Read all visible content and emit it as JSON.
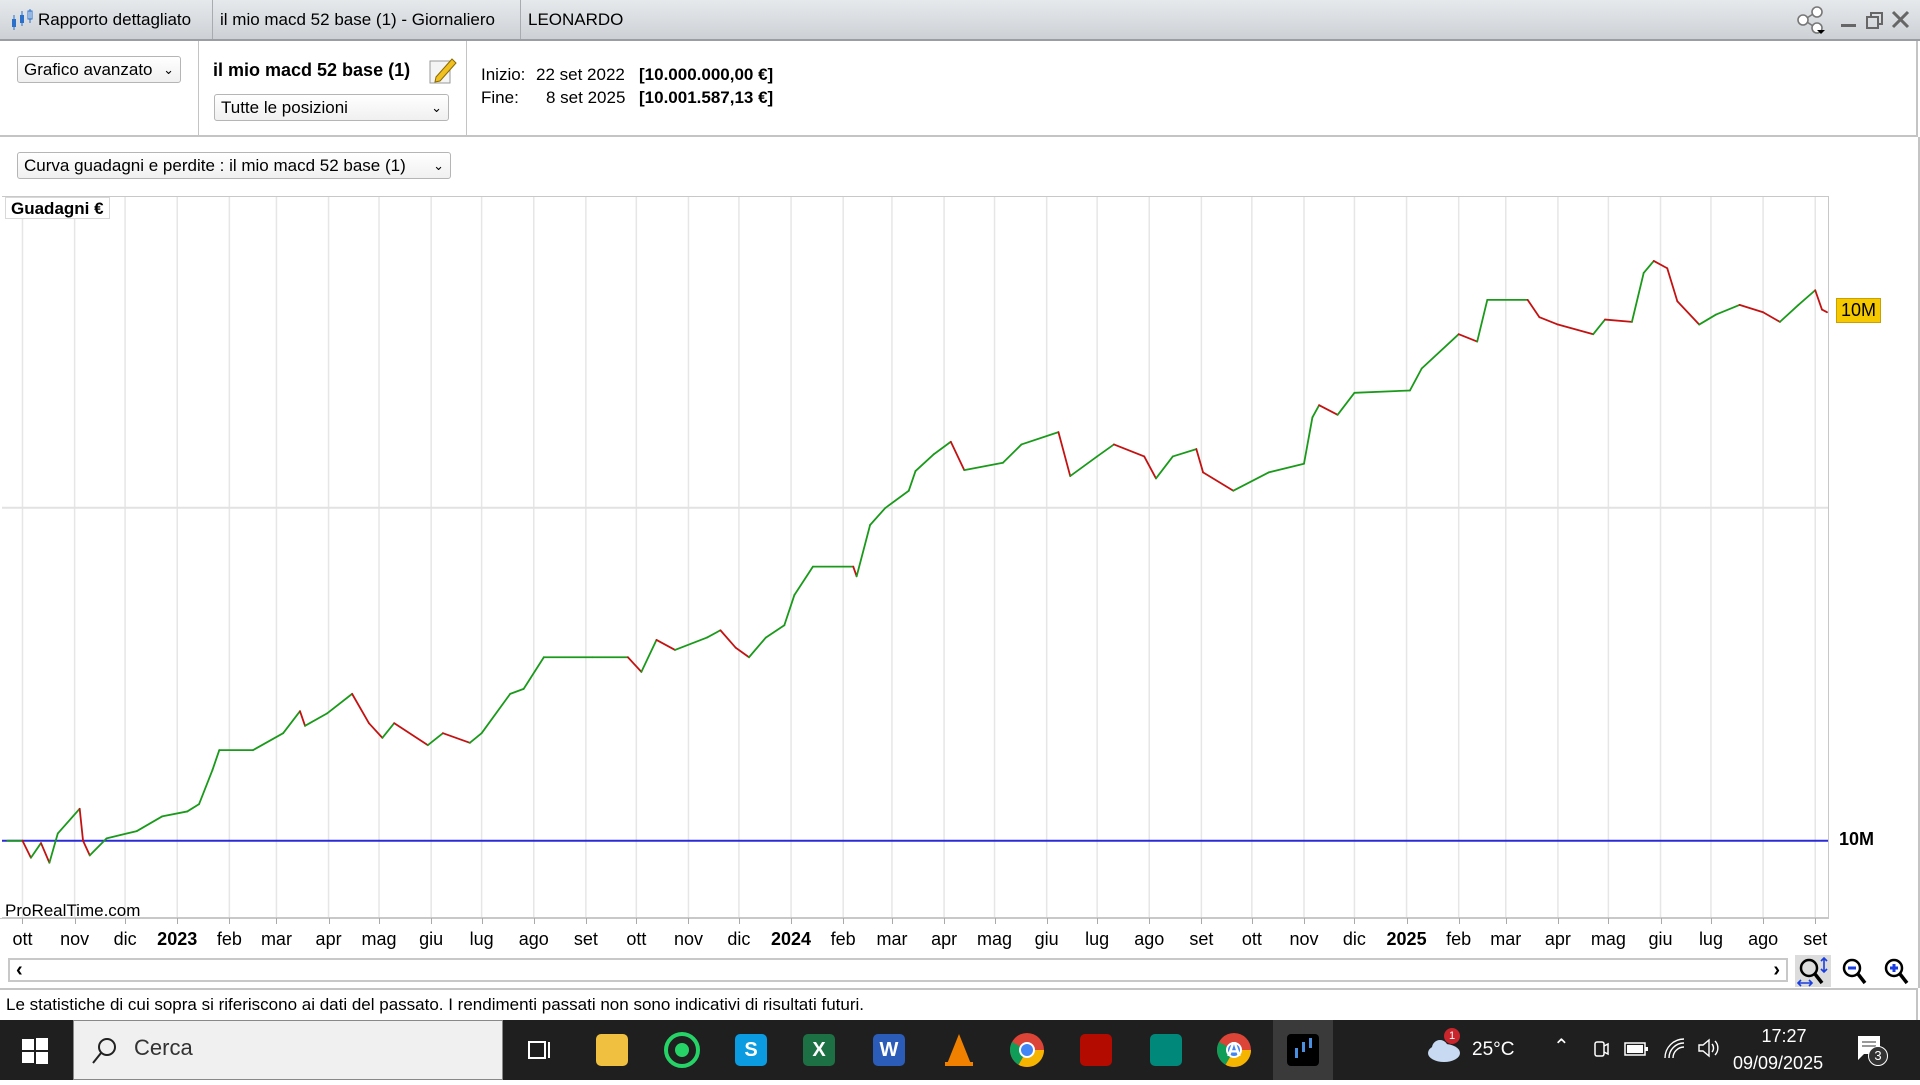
{
  "window": {
    "tabs": [
      {
        "label": "Rapporto dettagliato",
        "icon": "candlestick-icon"
      },
      {
        "label": "il mio macd 52 base (1) - Giornaliero"
      },
      {
        "label": "LEONARDO"
      }
    ],
    "controls": [
      "share-icon",
      "minimize-icon",
      "restore-icon",
      "close-icon"
    ]
  },
  "header": {
    "view_select": "Grafico avanzato",
    "system_name": "il mio macd 52 base (1)",
    "positions_select": "Tutte le posizioni",
    "start_label": "Inizio:",
    "start_date": "22 set 2022",
    "start_value": "[10.000.000,00 €]",
    "end_label": "Fine:",
    "end_date": "8 set 2025",
    "end_value": "[10.001.587,13 €]"
  },
  "curve_select": "Curva guadagni e perdite : il mio macd 52 base (1)",
  "chart_data": {
    "type": "line",
    "ylabel": "Guadagni €",
    "watermark": "ProRealTime.com",
    "xlim": [
      "2022-09-20",
      "2025-09-08"
    ],
    "ylim": [
      9999765,
      10001933
    ],
    "baseline": {
      "value": 10000000,
      "label": "10M",
      "color": "#2b2bd6"
    },
    "last_value_label": "10M",
    "last_value_color": "#f5c800",
    "up_color": "#1a9a1a",
    "down_color": "#c41212",
    "grid": true,
    "x_ticks": [
      {
        "date": "2022-10-01",
        "label": "ott"
      },
      {
        "date": "2022-11-01",
        "label": "nov"
      },
      {
        "date": "2022-12-01",
        "label": "dic"
      },
      {
        "date": "2023-01-01",
        "label": "2023",
        "year": true
      },
      {
        "date": "2023-02-01",
        "label": "feb"
      },
      {
        "date": "2023-03-01",
        "label": "mar"
      },
      {
        "date": "2023-04-01",
        "label": "apr"
      },
      {
        "date": "2023-05-01",
        "label": "mag"
      },
      {
        "date": "2023-06-01",
        "label": "giu"
      },
      {
        "date": "2023-07-01",
        "label": "lug"
      },
      {
        "date": "2023-08-01",
        "label": "ago"
      },
      {
        "date": "2023-09-01",
        "label": "set"
      },
      {
        "date": "2023-10-01",
        "label": "ott"
      },
      {
        "date": "2023-11-01",
        "label": "nov"
      },
      {
        "date": "2023-12-01",
        "label": "dic"
      },
      {
        "date": "2024-01-01",
        "label": "2024",
        "year": true
      },
      {
        "date": "2024-02-01",
        "label": "feb"
      },
      {
        "date": "2024-03-01",
        "label": "mar"
      },
      {
        "date": "2024-04-01",
        "label": "apr"
      },
      {
        "date": "2024-05-01",
        "label": "mag"
      },
      {
        "date": "2024-06-01",
        "label": "giu"
      },
      {
        "date": "2024-07-01",
        "label": "lug"
      },
      {
        "date": "2024-08-01",
        "label": "ago"
      },
      {
        "date": "2024-09-01",
        "label": "set"
      },
      {
        "date": "2024-10-01",
        "label": "ott"
      },
      {
        "date": "2024-11-01",
        "label": "nov"
      },
      {
        "date": "2024-12-01",
        "label": "dic"
      },
      {
        "date": "2025-01-01",
        "label": "2025",
        "year": true
      },
      {
        "date": "2025-02-01",
        "label": "feb"
      },
      {
        "date": "2025-03-01",
        "label": "mar"
      },
      {
        "date": "2025-04-01",
        "label": "apr"
      },
      {
        "date": "2025-05-01",
        "label": "mag"
      },
      {
        "date": "2025-06-01",
        "label": "giu"
      },
      {
        "date": "2025-07-01",
        "label": "lug"
      },
      {
        "date": "2025-08-01",
        "label": "ago"
      },
      {
        "date": "2025-09-01",
        "label": "set"
      }
    ],
    "y_gridlines": [
      10001000
    ],
    "points": [
      [
        "2022-09-22",
        10000000
      ],
      [
        "2022-10-01",
        10000000
      ],
      [
        "2022-10-06",
        9999949
      ],
      [
        "2022-10-12",
        9999993
      ],
      [
        "2022-10-17",
        9999934
      ],
      [
        "2022-10-22",
        10000022
      ],
      [
        "2022-11-04",
        10000096
      ],
      [
        "2022-11-06",
        10000000
      ],
      [
        "2022-11-10",
        9999956
      ],
      [
        "2022-11-20",
        10000007
      ],
      [
        "2022-12-08",
        10000029
      ],
      [
        "2022-12-23",
        10000073
      ],
      [
        "2023-01-07",
        10000088
      ],
      [
        "2023-01-14",
        10000110
      ],
      [
        "2023-01-22",
        10000213
      ],
      [
        "2023-01-26",
        10000272
      ],
      [
        "2023-02-15",
        10000272
      ],
      [
        "2023-03-05",
        10000323
      ],
      [
        "2023-03-15",
        10000389
      ],
      [
        "2023-03-18",
        10000345
      ],
      [
        "2023-03-31",
        10000382
      ],
      [
        "2023-04-15",
        10000441
      ],
      [
        "2023-04-25",
        10000353
      ],
      [
        "2023-05-03",
        10000309
      ],
      [
        "2023-05-10",
        10000353
      ],
      [
        "2023-05-30",
        10000287
      ],
      [
        "2023-06-08",
        10000323
      ],
      [
        "2023-06-24",
        10000294
      ],
      [
        "2023-07-01",
        10000323
      ],
      [
        "2023-07-18",
        10000441
      ],
      [
        "2023-07-26",
        10000456
      ],
      [
        "2023-08-07",
        10000551
      ],
      [
        "2023-09-05",
        10000551
      ],
      [
        "2023-09-26",
        10000551
      ],
      [
        "2023-10-04",
        10000507
      ],
      [
        "2023-10-13",
        10000603
      ],
      [
        "2023-10-24",
        10000573
      ],
      [
        "2023-11-12",
        10000610
      ],
      [
        "2023-11-20",
        10000632
      ],
      [
        "2023-11-29",
        10000580
      ],
      [
        "2023-12-07",
        10000551
      ],
      [
        "2023-12-17",
        10000610
      ],
      [
        "2023-12-28",
        10000647
      ],
      [
        "2024-01-03",
        10000738
      ],
      [
        "2024-01-14",
        10000823
      ],
      [
        "2024-02-07",
        10000823
      ],
      [
        "2024-02-09",
        10000794
      ],
      [
        "2024-02-17",
        10000948
      ],
      [
        "2024-02-26",
        10000999
      ],
      [
        "2024-03-11",
        10001051
      ],
      [
        "2024-03-15",
        10001110
      ],
      [
        "2024-03-26",
        10001161
      ],
      [
        "2024-04-05",
        10001198
      ],
      [
        "2024-04-13",
        10001113
      ],
      [
        "2024-05-06",
        10001135
      ],
      [
        "2024-05-17",
        10001190
      ],
      [
        "2024-06-08",
        10001227
      ],
      [
        "2024-06-15",
        10001095
      ],
      [
        "2024-07-01",
        10001154
      ],
      [
        "2024-07-11",
        10001190
      ],
      [
        "2024-07-29",
        10001154
      ],
      [
        "2024-08-05",
        10001088
      ],
      [
        "2024-08-15",
        10001154
      ],
      [
        "2024-08-29",
        10001176
      ],
      [
        "2024-09-02",
        10001106
      ],
      [
        "2024-09-20",
        10001051
      ],
      [
        "2024-10-11",
        10001106
      ],
      [
        "2024-11-01",
        10001132
      ],
      [
        "2024-11-06",
        10001271
      ],
      [
        "2024-11-10",
        10001308
      ],
      [
        "2024-11-21",
        10001279
      ],
      [
        "2024-12-01",
        10001345
      ],
      [
        "2025-01-03",
        10001352
      ],
      [
        "2025-01-10",
        10001418
      ],
      [
        "2025-02-01",
        10001521
      ],
      [
        "2025-02-12",
        10001499
      ],
      [
        "2025-02-18",
        10001624
      ],
      [
        "2025-03-14",
        10001624
      ],
      [
        "2025-03-21",
        10001572
      ],
      [
        "2025-04-01",
        10001550
      ],
      [
        "2025-04-22",
        10001521
      ],
      [
        "2025-04-29",
        10001565
      ],
      [
        "2025-05-15",
        10001558
      ],
      [
        "2025-05-22",
        10001705
      ],
      [
        "2025-05-28",
        10001741
      ],
      [
        "2025-06-05",
        10001719
      ],
      [
        "2025-06-11",
        10001620
      ],
      [
        "2025-06-24",
        10001550
      ],
      [
        "2025-07-04",
        10001580
      ],
      [
        "2025-07-18",
        10001609
      ],
      [
        "2025-08-01",
        10001587
      ],
      [
        "2025-08-11",
        10001558
      ],
      [
        "2025-08-22",
        10001609
      ],
      [
        "2025-09-01",
        10001653
      ],
      [
        "2025-09-05",
        10001595
      ],
      [
        "2025-09-08",
        10001587.13
      ]
    ]
  },
  "scrollbar": {
    "left": "‹",
    "right": "›"
  },
  "zoom_controls": [
    "zoom-fit-icon",
    "zoom-out-icon",
    "zoom-in-icon"
  ],
  "disclaimer": "Le statistiche di cui sopra si riferiscono ai dati del passato. I rendimenti passati non sono indicativi di risultati futuri.",
  "taskbar": {
    "search_placeholder": "Cerca",
    "apps": [
      {
        "name": "task-view",
        "color": "#ffffff",
        "glyph": ""
      },
      {
        "name": "file-explorer",
        "color": "#f0c040",
        "glyph": ""
      },
      {
        "name": "whatsapp",
        "color": "#25d366",
        "glyph": ""
      },
      {
        "name": "skype",
        "color": "#0a9be0",
        "glyph": "S"
      },
      {
        "name": "excel",
        "color": "#1d7044",
        "glyph": "X"
      },
      {
        "name": "word",
        "color": "#2b5cb8",
        "glyph": "W"
      },
      {
        "name": "vlc",
        "color": "#f08000",
        "glyph": ""
      },
      {
        "name": "chrome",
        "color": "#4285f4",
        "glyph": ""
      },
      {
        "name": "acrobat",
        "color": "#b30b00",
        "glyph": ""
      },
      {
        "name": "google-meet",
        "color": "#00897b",
        "glyph": ""
      },
      {
        "name": "chrome-profile",
        "color": "#4285f4",
        "glyph": "A"
      },
      {
        "name": "prorealtime",
        "color": "#000000",
        "glyph": ""
      }
    ],
    "weather_badge": "1",
    "temperature": "25°C",
    "time": "17:27",
    "date": "09/09/2025",
    "notifications": "3"
  }
}
